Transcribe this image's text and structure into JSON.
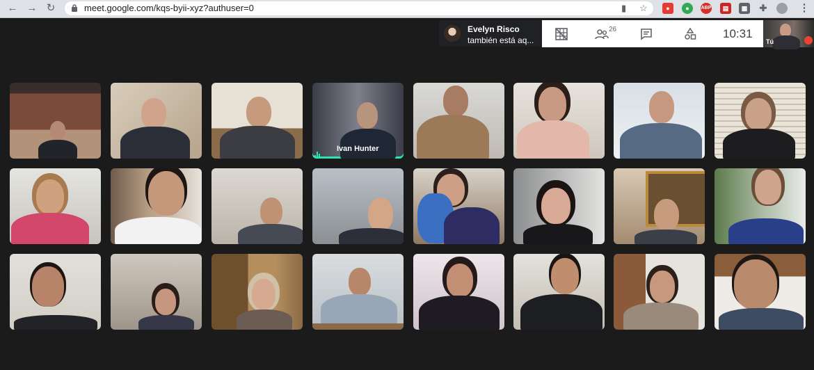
{
  "browser": {
    "url": "meet.google.com/kqs-byii-xyz?authuser=0",
    "extensions": [
      "ABP"
    ]
  },
  "notification": {
    "name": "Evelyn Risco",
    "text": "también está aq..."
  },
  "meet_toolbar": {
    "participant_count": "26",
    "time": "10:31"
  },
  "self_view": {
    "label": "Tú"
  },
  "participants": [
    {
      "name": "",
      "row": 1,
      "col": 1
    },
    {
      "name": "",
      "row": 1,
      "col": 2
    },
    {
      "name": "",
      "row": 1,
      "col": 3
    },
    {
      "name": "Ivan Hunter",
      "row": 1,
      "col": 4,
      "speaking": true
    },
    {
      "name": "",
      "row": 1,
      "col": 5
    },
    {
      "name": "",
      "row": 1,
      "col": 6
    },
    {
      "name": "",
      "row": 1,
      "col": 7
    },
    {
      "name": "",
      "row": 1,
      "col": 8
    },
    {
      "name": "",
      "row": 2,
      "col": 1
    },
    {
      "name": "",
      "row": 2,
      "col": 2
    },
    {
      "name": "",
      "row": 2,
      "col": 3
    },
    {
      "name": "",
      "row": 2,
      "col": 4
    },
    {
      "name": "",
      "row": 2,
      "col": 5
    },
    {
      "name": "",
      "row": 2,
      "col": 6
    },
    {
      "name": "",
      "row": 2,
      "col": 7
    },
    {
      "name": "",
      "row": 2,
      "col": 8
    },
    {
      "name": "",
      "row": 3,
      "col": 1
    },
    {
      "name": "",
      "row": 3,
      "col": 2
    },
    {
      "name": "",
      "row": 3,
      "col": 3
    },
    {
      "name": "",
      "row": 3,
      "col": 4
    },
    {
      "name": "",
      "row": 3,
      "col": 5
    },
    {
      "name": "",
      "row": 3,
      "col": 6
    },
    {
      "name": "",
      "row": 3,
      "col": 7
    },
    {
      "name": "",
      "row": 3,
      "col": 8
    }
  ],
  "colors": {
    "background": "#1b1b1b",
    "speaking_indicator": "#2ee3b0",
    "mic_off": "#ea4335"
  }
}
